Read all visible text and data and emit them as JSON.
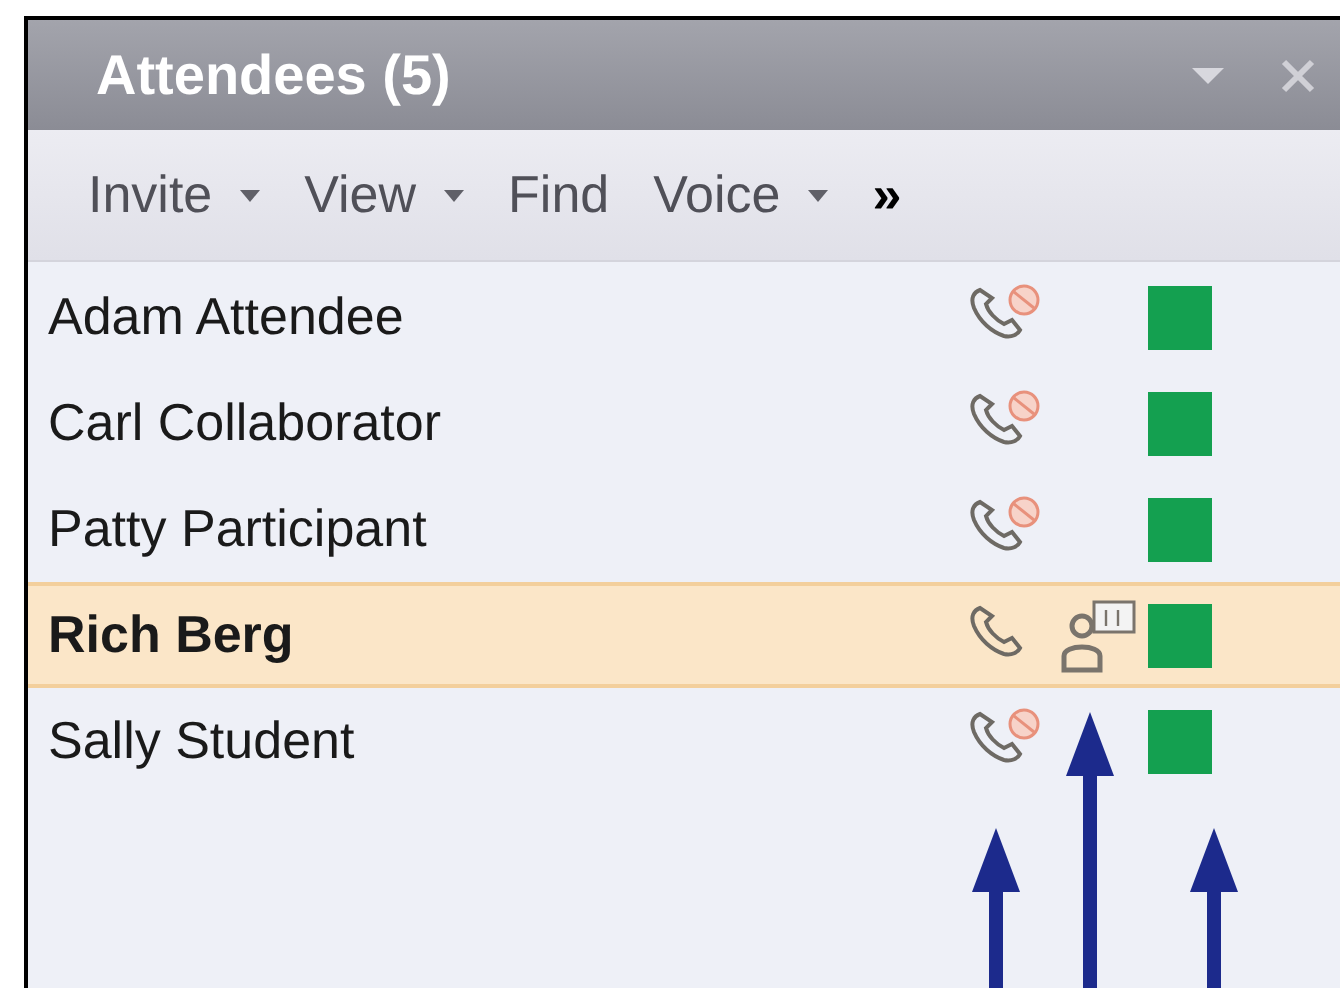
{
  "panel": {
    "title": "Attendees (5)"
  },
  "toolbar": [
    {
      "kind": "menu",
      "label": "Invite",
      "dropdown": true
    },
    {
      "kind": "menu",
      "label": "View",
      "dropdown": true
    },
    {
      "kind": "menu",
      "label": "Find",
      "dropdown": false
    },
    {
      "kind": "menu",
      "label": "Voice",
      "dropdown": true
    },
    {
      "kind": "overflow",
      "label": "»"
    }
  ],
  "attendees": [
    {
      "name": "Adam Attendee",
      "selected": false,
      "voice_muted": true,
      "presenter": false,
      "color": "#14a050"
    },
    {
      "name": "Carl Collaborator",
      "selected": false,
      "voice_muted": true,
      "presenter": false,
      "color": "#14a050"
    },
    {
      "name": "Patty Participant",
      "selected": false,
      "voice_muted": true,
      "presenter": false,
      "color": "#14a050"
    },
    {
      "name": "Rich Berg",
      "selected": true,
      "voice_muted": false,
      "presenter": true,
      "color": "#14a050"
    },
    {
      "name": "Sally Student",
      "selected": false,
      "voice_muted": true,
      "presenter": false,
      "color": "#14a050"
    }
  ]
}
